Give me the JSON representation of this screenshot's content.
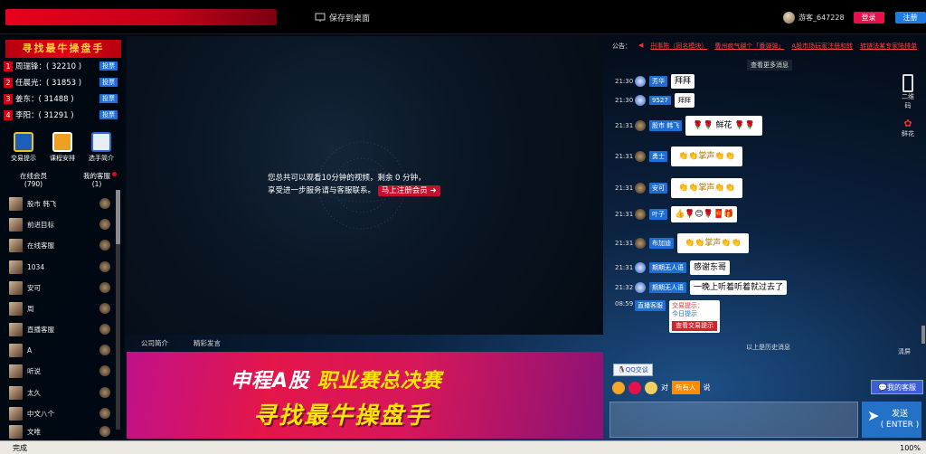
{
  "header": {
    "save_desktop": "保存到桌面",
    "username": "游客_647228",
    "login": "登录",
    "register": "注册"
  },
  "left": {
    "title": "寻找最牛操盘手",
    "ranks": [
      {
        "num": "1",
        "name": "周瑞锋：( 32210 )",
        "vote": "投票"
      },
      {
        "num": "2",
        "name": "任晨光：( 31853 )",
        "vote": "投票"
      },
      {
        "num": "3",
        "name": "姜东：( 31488 )",
        "vote": "投票"
      },
      {
        "num": "4",
        "name": "李阳：( 31291 )",
        "vote": "投票"
      }
    ],
    "tools": [
      "交易提示",
      "课程安排",
      "选手简介"
    ],
    "tab_online": "在线会员",
    "tab_online_count": "(790)",
    "tab_service": "我的客服",
    "tab_service_count": "(1)",
    "members": [
      "股市 韩飞",
      "前进目标",
      "在线客服",
      "1034",
      "安可",
      "周",
      "直播客服",
      "A",
      "听说",
      "太久",
      "中文八个",
      "文唯"
    ]
  },
  "video": {
    "notice_line1": "您总共可以观看10分钟的视频，剩余 0 分钟，",
    "notice_line2": "享受进一步服务请与客服联系。",
    "register_cta": "马上注册会员"
  },
  "bottom_tabs": [
    "公司简介",
    "精彩发言"
  ],
  "banner": {
    "line1_white": "申程A股 ",
    "line1_yellow": "职业赛总决赛",
    "line2": "寻找最牛操盘手"
  },
  "chat": {
    "announce_label": "公告：",
    "announcements": [
      "刑事陈（同名模块）",
      "曹州疯气疆个「番弹弹」",
      "A股市场玩家注册和转",
      "转链法某专家陆排单"
    ],
    "more": "查看更多消息",
    "messages": [
      {
        "time": "21:30",
        "name": "芳华",
        "text": "拜拜"
      },
      {
        "time": "21:30",
        "name": "9527",
        "text": "拜拜"
      },
      {
        "time": "21:31",
        "name": "股市 韩飞",
        "text": "🌹🌹 鲜花 🌹🌹"
      },
      {
        "time": "21:31",
        "name": "勇士",
        "text": "👏👏掌声👏👏"
      },
      {
        "time": "21:31",
        "name": "安可",
        "text": "👏👏掌声👏👏"
      },
      {
        "time": "21:31",
        "name": "叶子",
        "text": "👍🌹😊🌹🧧🎁"
      },
      {
        "time": "21:31",
        "name": "布加迪",
        "text": "👏👏掌声👏👏"
      },
      {
        "time": "21:31",
        "name": "期期无人语",
        "text": "感谢东哥"
      },
      {
        "time": "21:32",
        "name": "期期无人语",
        "text": "一晚上听着听着就过去了"
      }
    ],
    "tip": {
      "time": "08:59",
      "name": "直播客服",
      "line1": "交易提示：",
      "line2": "今日提示",
      "button": "查看交易提示"
    },
    "side_qr": "二维码",
    "side_flower": "鲜花",
    "history": "以上是历史消息",
    "clear": "清屏",
    "qq": "QQ交谈",
    "to": "对",
    "all": "所有人",
    "say": "说",
    "my_service": "我的客服",
    "send": "发送",
    "send_key": "( ENTER )"
  },
  "status": {
    "text": "完成",
    "zoom": "100%"
  }
}
